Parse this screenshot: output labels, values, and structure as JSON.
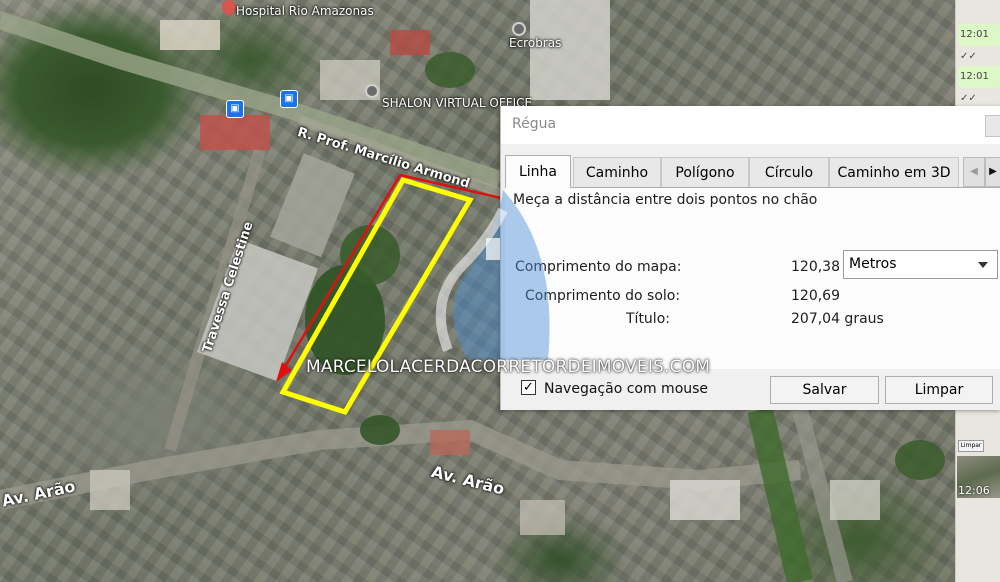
{
  "map": {
    "labels": {
      "hospital": "Hospital Rio Amazonas",
      "store": "Ecrobras",
      "shalon": "SHALON VIRTUAL OFFICE",
      "street_prof": "R. Prof. Marcílio Armond",
      "travessa": "Travessa Celestine",
      "av_arao_1": "Av. Arão",
      "av_arao_2": "Av. Arão"
    },
    "colors": {
      "measure_line": "#e01010",
      "plot_outline": "#ffff00"
    }
  },
  "chat": {
    "times": [
      "12:01",
      "12:01",
      "12:06"
    ],
    "mini_button": "Limpar"
  },
  "dialog": {
    "title": "Régua",
    "tabs": [
      "Linha",
      "Caminho",
      "Polígono",
      "Círculo",
      "Caminho em 3D"
    ],
    "active_tab": "Linha",
    "instruction": "Meça a distância entre dois pontos no chão",
    "map_length_label": "Comprimento do mapa:",
    "map_length_value": "120,38",
    "units": "Metros",
    "ground_length_label": "Comprimento do solo:",
    "ground_length_value": "120,69",
    "heading_label": "Título:",
    "heading_value": "207,04 graus",
    "mouse_nav_label": "Navegação com mouse",
    "mouse_nav_checked": true,
    "save_label": "Salvar",
    "clear_label": "Limpar"
  },
  "watermark": {
    "text": "MARCELOLACERDACORRETORDEIMOVEIS.COM"
  }
}
